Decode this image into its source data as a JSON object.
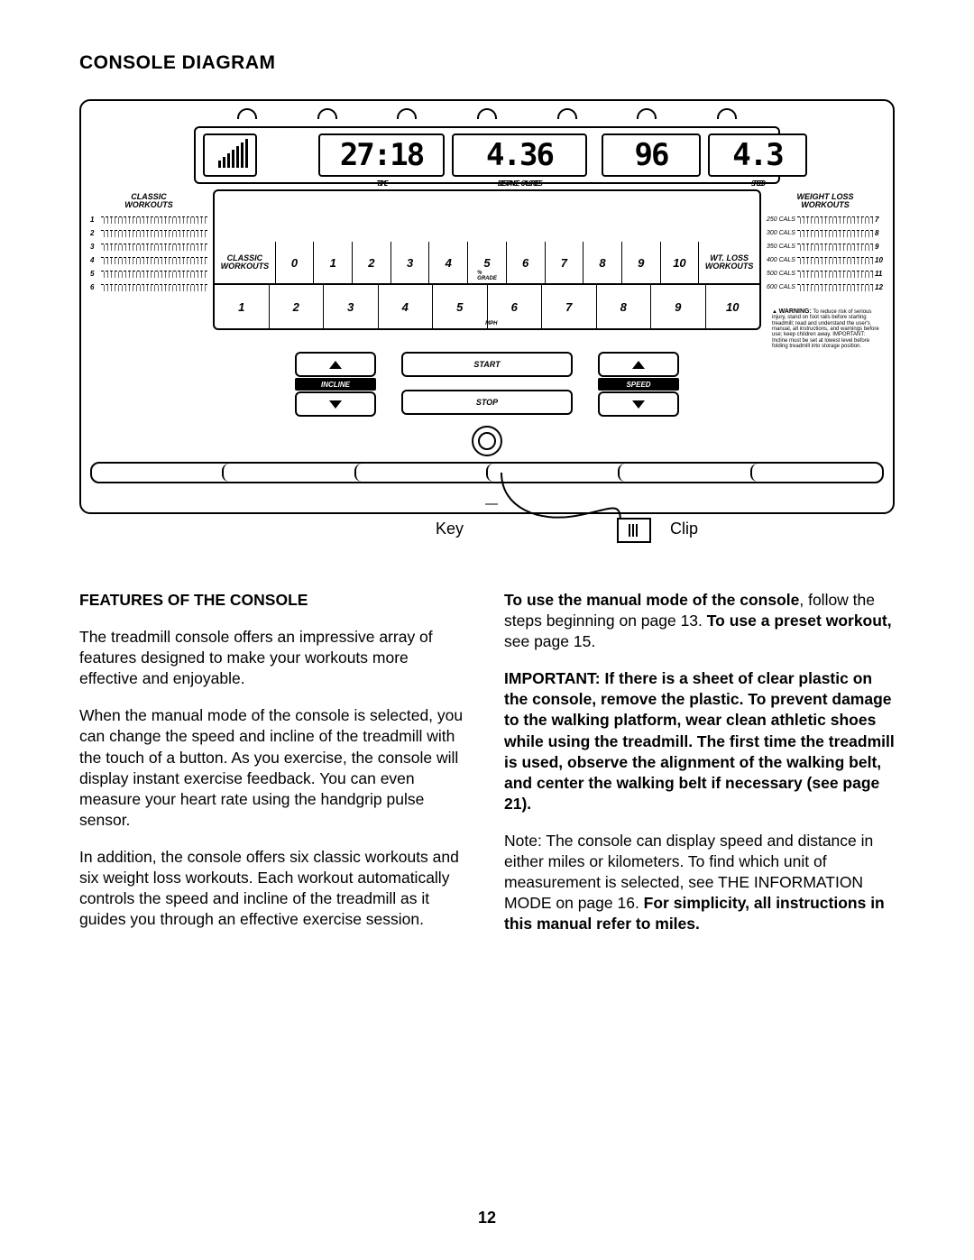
{
  "title": "CONSOLE DIAGRAM",
  "hinge_count": 7,
  "display": {
    "time_label": "TIME",
    "time_value": "27:18",
    "dist_label": "DISTANCE  CALORIES",
    "dist_value": "4.36",
    "cal_value": "96",
    "speed_label": "SPEED",
    "speed_value": "4.3"
  },
  "classic": {
    "header": "CLASSIC\nWORKOUTS",
    "rows": [
      "1",
      "2",
      "3",
      "4",
      "5",
      "6"
    ]
  },
  "weightloss": {
    "header": "WEIGHT LOSS\nWORKOUTS",
    "rows": [
      {
        "n": "7",
        "tag": "250 CALS"
      },
      {
        "n": "8",
        "tag": "300 CALS"
      },
      {
        "n": "9",
        "tag": "350 CALS"
      },
      {
        "n": "10",
        "tag": "400 CALS"
      },
      {
        "n": "11",
        "tag": "500 CALS"
      },
      {
        "n": "12",
        "tag": "600 CALS"
      }
    ]
  },
  "grade_strip": {
    "left": "CLASSIC\nWORKOUTS",
    "right": "WT. LOSS\nWORKOUTS",
    "nums": [
      "0",
      "1",
      "2",
      "3",
      "4",
      "5",
      "6",
      "7",
      "8",
      "9",
      "10"
    ],
    "sub": "% GRADE"
  },
  "mph_strip": {
    "nums": [
      "1",
      "2",
      "3",
      "4",
      "5",
      "6",
      "7",
      "8",
      "9",
      "10"
    ],
    "sub": "MPH"
  },
  "controls": {
    "incline": "INCLINE",
    "speed": "SPEED",
    "start": "START",
    "stop": "STOP"
  },
  "warning_label": "WARNING:",
  "warning_text": "To reduce risk of serious injury, stand on foot rails before starting treadmill; read and understand the user's manual, all instructions, and warnings before use; keep children away. IMPORTANT: Incline must be set at lowest level before folding treadmill into storage position.",
  "key_label": "Key",
  "clip_label": "Clip",
  "features_heading": "FEATURES OF THE CONSOLE",
  "p1": "The treadmill console offers an impressive array of features designed to make your workouts more effective and enjoyable.",
  "p2": "When the manual mode of the console is selected, you can change the speed and incline of the treadmill with the touch of a button. As you exercise, the console will display instant exercise feedback. You can even measure your heart rate using the handgrip pulse sensor.",
  "p3": "In addition, the console offers six classic workouts and six weight loss workouts. Each workout automatically controls the speed and incline of the treadmill as it guides you through an effective exercise session.",
  "r1a": "To use the manual mode of the console",
  "r1b": ", follow the steps beginning on page 13. ",
  "r1c": "To use a preset workout,",
  "r1d": " see page 15.",
  "r2": "IMPORTANT: If there is a sheet of clear plastic on the console, remove the plastic. To prevent damage to the walking platform, wear clean athletic shoes while using the treadmill. The first time the treadmill is used, observe the alignment of the walking belt, and center the walking belt if necessary (see page 21).",
  "r3a": "Note: The console can display speed and distance in either miles or kilometers. To find which unit of measurement is selected, see THE INFORMATION MODE on page 16. ",
  "r3b": "For simplicity, all instructions in this manual refer to miles.",
  "page_number": "12"
}
